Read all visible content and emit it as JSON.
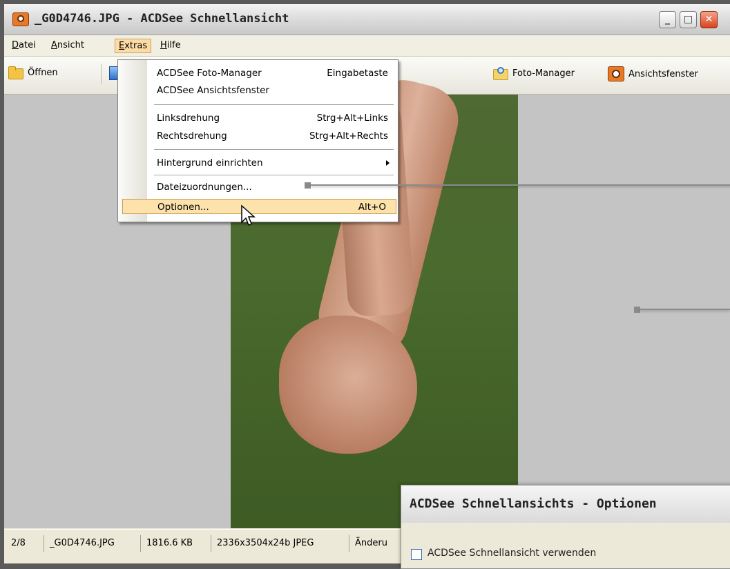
{
  "window": {
    "title": "_G0D4746.JPG - ACDSee Schnellansicht"
  },
  "menubar": {
    "items": [
      {
        "label": "Datei",
        "underline": "D"
      },
      {
        "label": "Ansicht",
        "underline": "A"
      },
      {
        "label": "Extras",
        "underline": "E"
      },
      {
        "label": "Hilfe",
        "underline": "H"
      }
    ]
  },
  "toolbar": {
    "open_label": "Öffnen",
    "photo_manager_label": "Foto-Manager",
    "viewer_window_label": "Ansichtsfenster"
  },
  "extras_menu": {
    "items": [
      {
        "label": "ACDSee Foto-Manager",
        "shortcut": "Eingabetaste"
      },
      {
        "label": "ACDSee Ansichtsfenster",
        "shortcut": ""
      },
      {
        "label": "Linksdrehung",
        "shortcut": "Strg+Alt+Links"
      },
      {
        "label": "Rechtsdrehung",
        "shortcut": "Strg+Alt+Rechts"
      },
      {
        "label": "Hintergrund einrichten",
        "shortcut": ""
      },
      {
        "label": "Dateizuordnungen...",
        "shortcut": ""
      },
      {
        "label": "Optionen...",
        "shortcut": "Alt+O"
      }
    ]
  },
  "statusbar": {
    "position": "2/8",
    "filename": "_G0D4746.JPG",
    "filesize": "1816.6 KB",
    "dimensions": "2336x3504x24b JPEG",
    "modified": "Änderu"
  },
  "options_dialog": {
    "title": "ACDSee Schnellansichts - Optionen",
    "checkbox_text": "ACDSee Schnellansicht verwenden"
  }
}
